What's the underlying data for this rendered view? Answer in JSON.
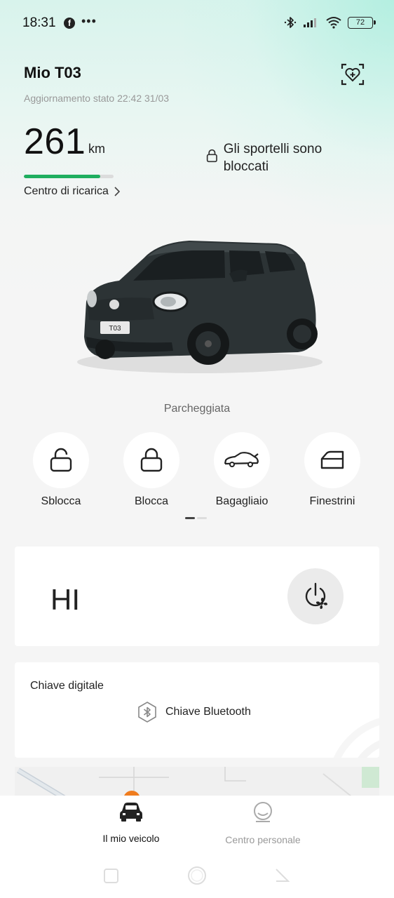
{
  "status_bar": {
    "time": "18:31",
    "facebook_glyph": "f",
    "more": "•••",
    "battery": "72",
    "icons": [
      "facebook-icon",
      "bluetooth-icon",
      "signal-icon",
      "wifi-icon",
      "battery-icon"
    ]
  },
  "header": {
    "title": "Mio T03",
    "update_text": "Aggiornamento stato 22:42 31/03"
  },
  "range": {
    "value": "261",
    "unit": "km",
    "level_percent": 85,
    "charging_link": "Centro di ricarica",
    "bar_color": "#1fae5f"
  },
  "lock_status": "Gli sportelli sono bloccati",
  "car": {
    "plate": "T03",
    "state": "Parcheggiata"
  },
  "actions": [
    {
      "label": "Sblocca",
      "icon": "unlock-icon"
    },
    {
      "label": "Blocca",
      "icon": "lock-icon"
    },
    {
      "label": "Bagagliaio",
      "icon": "trunk-icon"
    },
    {
      "label": "Finestrini",
      "icon": "window-icon"
    }
  ],
  "greeting_card": {
    "text": "HI",
    "button_icon": "climate-power-icon"
  },
  "digital_key": {
    "title": "Chiave digitale",
    "bluetooth_label": "Chiave Bluetooth"
  },
  "bottom_nav": [
    {
      "label": "Il mio veicolo",
      "active": true,
      "icon": "car-icon"
    },
    {
      "label": "Centro personale",
      "active": false,
      "icon": "profile-icon"
    }
  ],
  "colors": {
    "accent_green": "#1fae5f",
    "header_tint": "#d8f3ec"
  }
}
